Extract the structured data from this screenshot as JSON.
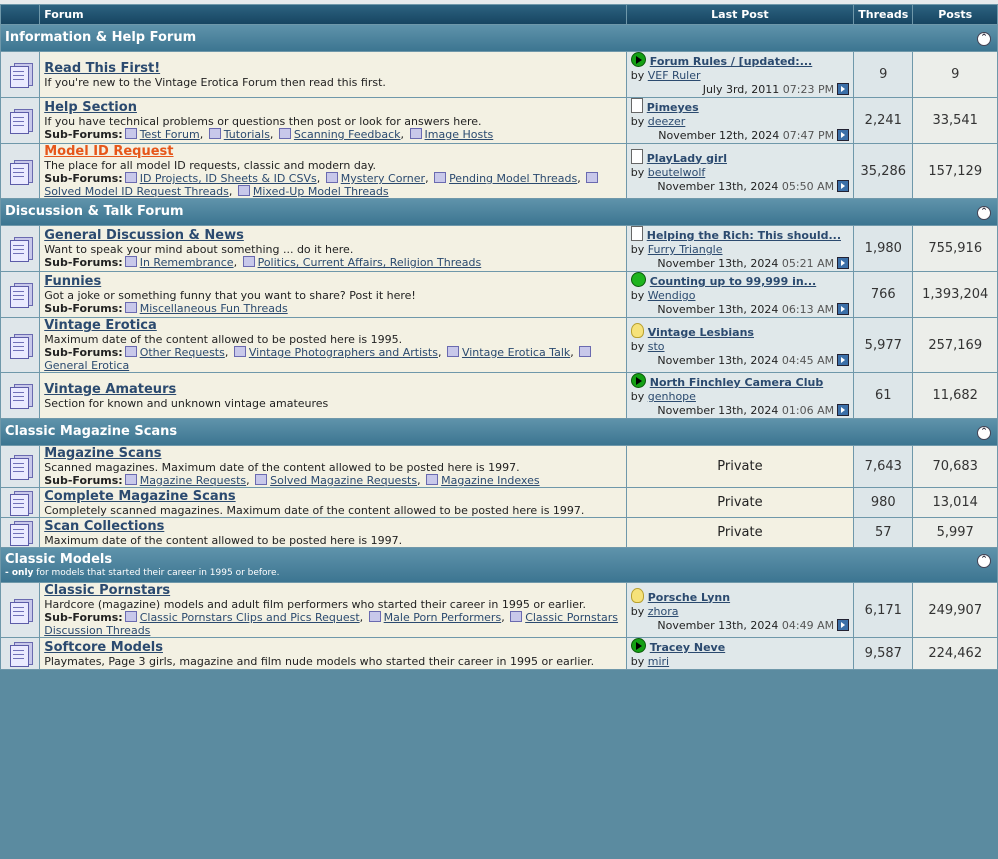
{
  "header": {
    "forum": "Forum",
    "last_post": "Last Post",
    "threads": "Threads",
    "posts": "Posts"
  },
  "categories": [
    {
      "title": "Information & Help Forum",
      "collapse_icon": "collapse-icon",
      "forums": [
        {
          "title": "Read This First!",
          "hot": false,
          "desc": "If you're new to the Vintage Erotica Forum then read this first.",
          "subforums_label": "",
          "subforums": [],
          "last": {
            "icon": "arrow",
            "title": "Forum Rules / [updated:...",
            "by_label": "by",
            "by": "VEF Ruler",
            "date": "July 3rd, 2011",
            "time": "07:23 PM"
          },
          "threads": "9",
          "posts": "9"
        },
        {
          "title": "Help Section",
          "hot": false,
          "desc": "If you have technical problems or questions then post or look for answers here.",
          "subforums_label": "Sub-Forums:",
          "subforums": [
            "Test Forum",
            "Tutorials",
            "Scanning Feedback",
            "Image Hosts"
          ],
          "last": {
            "icon": "doc",
            "title": "Pimeyes",
            "by_label": "by",
            "by": "deezer",
            "date": "November 12th, 2024",
            "time": "07:47 PM"
          },
          "threads": "2,241",
          "posts": "33,541"
        },
        {
          "title": "Model ID Request",
          "hot": true,
          "desc": "The place for all model ID requests, classic and modern day.",
          "subforums_label": "Sub-Forums:",
          "subforums": [
            "ID Projects, ID Sheets & ID CSVs",
            "Mystery Corner",
            "Pending Model Threads",
            "Solved Model ID Request Threads",
            "Mixed-Up Model Threads"
          ],
          "last": {
            "icon": "doc",
            "title": "PlayLady girl",
            "by_label": "by",
            "by": "beutelwolf",
            "date": "November 13th, 2024",
            "time": "05:50 AM"
          },
          "threads": "35,286",
          "posts": "157,129"
        }
      ]
    },
    {
      "title": "Discussion & Talk Forum",
      "collapse_icon": "collapse-icon",
      "forums": [
        {
          "title": "General Discussion & News",
          "hot": false,
          "desc": "Want to speak your mind about something ... do it here.",
          "subforums_label": "Sub-Forums:",
          "subforums": [
            "In Remembrance",
            "Politics, Current Affairs, Religion Threads"
          ],
          "last": {
            "icon": "doc",
            "title": "Helping the Rich: This should...",
            "by_label": "by",
            "by": "Furry Triangle",
            "date": "November 13th, 2024",
            "time": "05:21 AM"
          },
          "threads": "1,980",
          "posts": "755,916"
        },
        {
          "title": "Funnies",
          "hot": false,
          "desc": "Got a joke or something funny that you want to share? Post it here!",
          "subforums_label": "Sub-Forums:",
          "subforums": [
            "Miscellaneous Fun Threads"
          ],
          "last": {
            "icon": "grin",
            "title": "Counting up to 99,999 in...",
            "by_label": "by",
            "by": "Wendigo",
            "date": "November 13th, 2024",
            "time": "06:13 AM"
          },
          "threads": "766",
          "posts": "1,393,204"
        },
        {
          "title": "Vintage Erotica",
          "hot": false,
          "desc": "Maximum date of the content allowed to be posted here is 1995.",
          "subforums_label": "Sub-Forums:",
          "subforums": [
            "Other Requests",
            "Vintage Photographers and Artists",
            "Vintage Erotica Talk",
            "General Erotica"
          ],
          "last": {
            "icon": "bulb",
            "title": "Vintage Lesbians",
            "by_label": "by",
            "by": "sto",
            "date": "November 13th, 2024",
            "time": "04:45 AM"
          },
          "threads": "5,977",
          "posts": "257,169"
        },
        {
          "title": "Vintage Amateurs",
          "hot": false,
          "desc": "Section for known and unknown vintage amateures",
          "subforums_label": "",
          "subforums": [],
          "last": {
            "icon": "arrow",
            "title": "North Finchley Camera Club",
            "by_label": "by",
            "by": "genhope",
            "date": "November 13th, 2024",
            "time": "01:06 AM"
          },
          "threads": "61",
          "posts": "11,682"
        }
      ]
    },
    {
      "title": "Classic Magazine Scans",
      "collapse_icon": "collapse-icon",
      "forums": [
        {
          "title": "Magazine Scans",
          "hot": false,
          "desc": "Scanned magazines. Maximum date of the content allowed to be posted here is 1997.",
          "subforums_label": "Sub-Forums:",
          "subforums": [
            "Magazine Requests",
            "Solved Magazine Requests",
            "Magazine Indexes"
          ],
          "private": "Private",
          "threads": "7,643",
          "posts": "70,683"
        },
        {
          "title": "Complete Magazine Scans",
          "hot": false,
          "desc": "Completely scanned magazines. Maximum date of the content allowed to be posted here is 1997.",
          "subforums_label": "",
          "subforums": [],
          "private": "Private",
          "threads": "980",
          "posts": "13,014"
        },
        {
          "title": "Scan Collections",
          "hot": false,
          "desc": "Maximum date of the content allowed to be posted here is 1997.",
          "subforums_label": "",
          "subforums": [],
          "private": "Private",
          "threads": "57",
          "posts": "5,997"
        }
      ]
    },
    {
      "title": "Classic Models",
      "sub_bold": "- only",
      "sub_rest": " for models that started their career in 1995 or before.",
      "collapse_icon": "collapse-icon",
      "forums": [
        {
          "title": "Classic Pornstars",
          "hot": false,
          "desc": "Hardcore (magazine) models and adult film performers who started their career in 1995 or earlier.",
          "subforums_label": "Sub-Forums:",
          "subforums": [
            "Classic Pornstars Clips and Pics Request",
            "Male Porn Performers",
            "Classic Pornstars Discussion Threads"
          ],
          "last": {
            "icon": "bulb",
            "title": "Porsche Lynn",
            "by_label": "by",
            "by": "zhora",
            "date": "November 13th, 2024",
            "time": "04:49 AM"
          },
          "threads": "6,171",
          "posts": "249,907"
        },
        {
          "title": "Softcore Models",
          "hot": false,
          "desc": "Playmates, Page 3 girls, magazine and film nude models who started their career in 1995 or earlier.",
          "subforums_label": "",
          "subforums": [],
          "last": {
            "icon": "arrow",
            "title": "Tracey Neve",
            "by_label": "by",
            "by": "miri",
            "date": "",
            "time": ""
          },
          "threads": "9,587",
          "posts": "224,462"
        }
      ]
    }
  ]
}
